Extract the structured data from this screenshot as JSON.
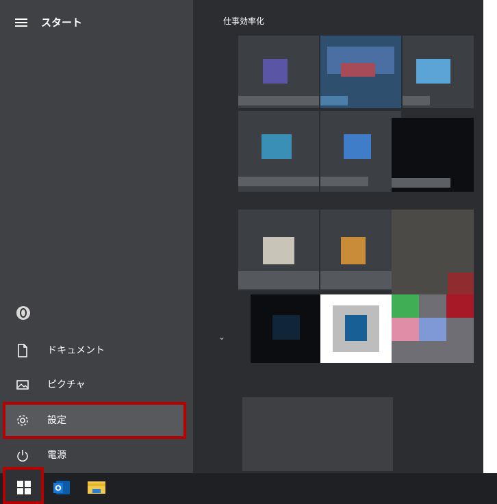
{
  "start_menu": {
    "title": "スタート",
    "left_items": [
      {
        "id": "user-account",
        "label": "",
        "icon": "user-icon"
      },
      {
        "id": "documents",
        "label": "ドキュメント",
        "icon": "document-icon"
      },
      {
        "id": "pictures",
        "label": "ピクチャ",
        "icon": "picture-icon"
      },
      {
        "id": "settings",
        "label": "設定",
        "icon": "gear-icon"
      },
      {
        "id": "power",
        "label": "電源",
        "icon": "power-icon"
      }
    ]
  },
  "tiles": {
    "group_title": "仕事効率化",
    "blurred": true
  },
  "taskbar": {
    "apps": [
      {
        "id": "start",
        "icon": "windows-logo-icon"
      },
      {
        "id": "outlook",
        "icon": "outlook-icon"
      },
      {
        "id": "file-explorer",
        "icon": "file-explorer-icon"
      }
    ]
  },
  "colors": {
    "highlight": "#b70000",
    "menu_bg": "#3f4145",
    "tiles_bg": "#2b2d31",
    "taskbar_bg": "#1f2023"
  }
}
